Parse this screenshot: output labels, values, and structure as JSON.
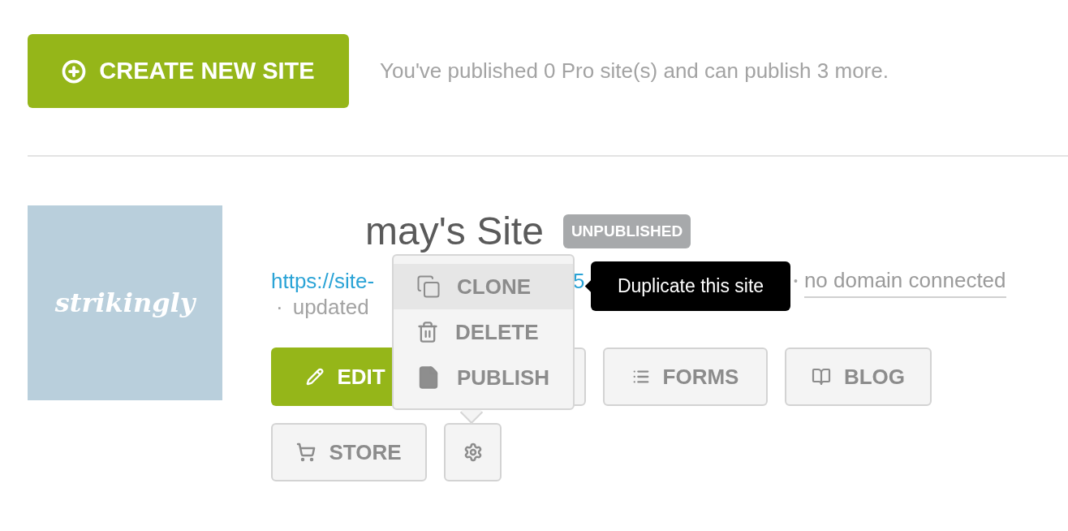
{
  "header": {
    "create_button": "CREATE NEW SITE",
    "quota_text": "You've published 0 Pro site(s) and can publish 3 more."
  },
  "site": {
    "thumbnail_logo": "strikingly",
    "title": "may's Site",
    "status_badge": "UNPUBLISHED",
    "url_parts": [
      "https://site-",
      "5"
    ],
    "separator": "•",
    "domain": "no domain connected",
    "updated_bullet": "·",
    "updated": "updated",
    "buttons": [
      {
        "kind": "primary",
        "label": "EDIT"
      },
      {
        "kind": "covered"
      },
      {
        "kind": "secondary",
        "label": "FORMS"
      },
      {
        "kind": "secondary",
        "label": "BLOG"
      },
      {
        "kind": "secondary",
        "label": "STORE"
      },
      {
        "kind": "icon-only"
      }
    ]
  },
  "menu": {
    "items": [
      {
        "label": "CLONE",
        "selected": true
      },
      {
        "label": "DELETE",
        "selected": false
      },
      {
        "label": "PUBLISH",
        "selected": false
      }
    ]
  },
  "tooltip": "Duplicate this site"
}
